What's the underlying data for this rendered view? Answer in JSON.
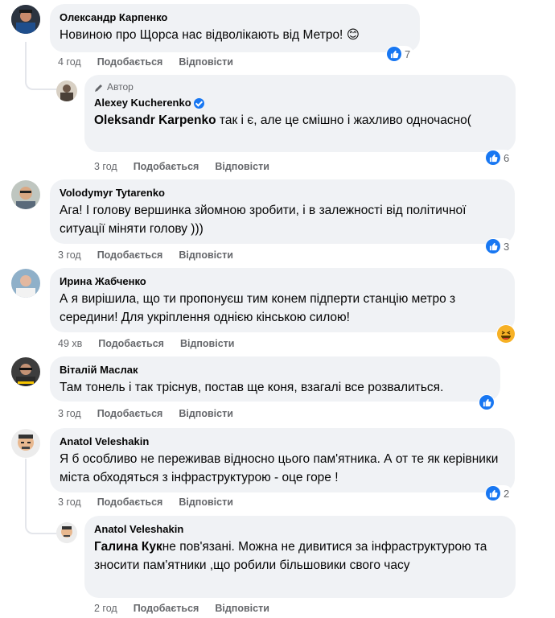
{
  "comments": [
    {
      "name": "Олександр Карпенко",
      "text": "Новиною про Щорса нас відволікають від Метро!",
      "time": "4 год",
      "like": "Подобається",
      "reply": "Відповісти",
      "reactions": "7",
      "emoji": "😊"
    },
    {
      "author_tag": "Автор",
      "name": "Alexey Kucherenko",
      "mention": "Oleksandr Karpenko",
      "text": " так і є, але це смішно і жахливо одночасно(",
      "time": "3 год",
      "like": "Подобається",
      "reply": "Відповісти",
      "reactions": "6"
    },
    {
      "name": "Volodymyr Tytarenko",
      "text": "Ага! І голову вершинка зйомною зробити, і в залежності від політичної ситуації міняти голову )))",
      "time": "3 год",
      "like": "Подобається",
      "reply": "Відповісти",
      "reactions": "3"
    },
    {
      "name": "Ирина Жабченко",
      "text": "А я вирішила, що ти пропонуєш тим конем підперти станцію метро з середини! Для укріплення однією кінською силою!",
      "time": "49 хв",
      "like": "Подобається",
      "reply": "Відповісти"
    },
    {
      "name": "Віталій Маслак",
      "text": "Там тонель і так тріснув, постав ще коня, взагалі все розвалиться.",
      "time": "3 год",
      "like": "Подобається",
      "reply": "Відповісти"
    },
    {
      "name": "Anatol Veleshakin",
      "text": "Я б особливо не переживав відносно цього пам'ятника. А от те як керівники міста обходяться з інфраструктурою - оце горе !",
      "time": "3 год",
      "like": "Подобається",
      "reply": "Відповісти",
      "reactions": "2"
    },
    {
      "name": "Anatol Veleshakin",
      "mention": "Галина Кук",
      "text": "не пов'язані. Можна не дивитися за інфраструктурою та зносити пам'ятники ,що робили більшовики свого часу",
      "time": "2 год",
      "like": "Подобається",
      "reply": "Відповісти"
    }
  ],
  "colors": {
    "bubble": "#f0f2f5",
    "like": "#1877f2",
    "meta": "#65676b"
  }
}
